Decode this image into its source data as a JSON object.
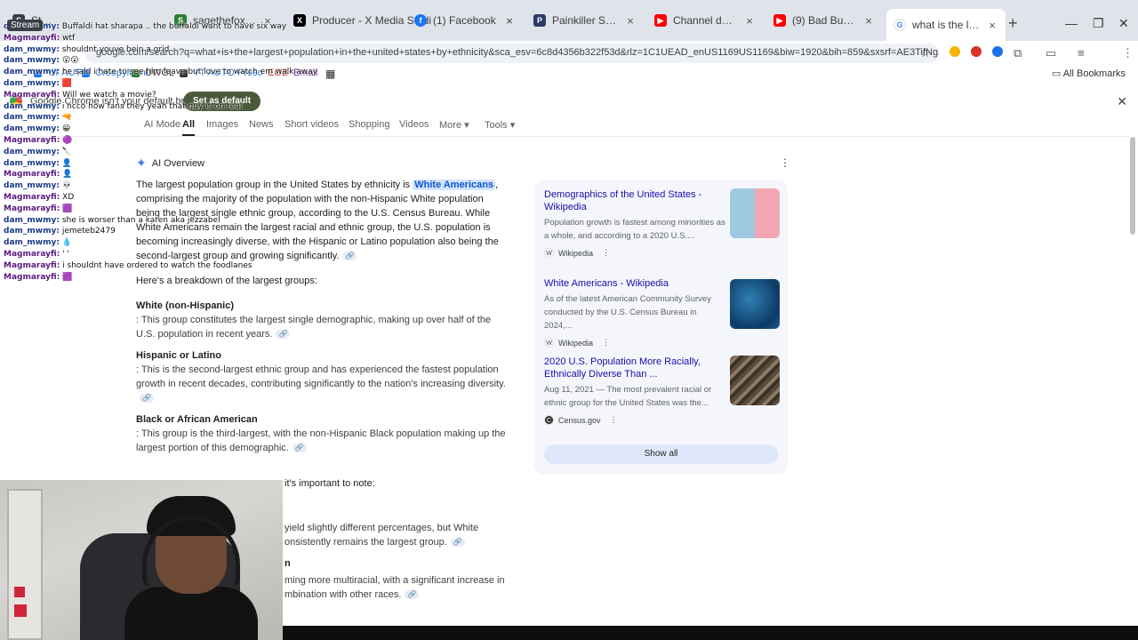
{
  "tabs": [
    {
      "title": "Stream",
      "color": "#3a3f47"
    },
    {
      "title": "sagethefox Stream - ",
      "color": "#2e7d32"
    },
    {
      "title": "Producer - X Media Studi",
      "color": "#000000"
    },
    {
      "title": "(1) Facebook",
      "color": "#1877f2"
    },
    {
      "title": "Painkiller Season 1 Episo",
      "color": "#2b3a67"
    },
    {
      "title": "Channel dashboard - Yo",
      "color": "#ff0000"
    },
    {
      "title": "(9) Bad Bunny - Tití Me P",
      "color": "#ff0000"
    },
    {
      "title": "what is the largest popul",
      "color": "#4285f4"
    }
  ],
  "omnibox": {
    "url": "google.com/search?q=what+is+the+largest+population+in+the+united+states+by+ethnicity&sca_esv=6c8d4356b322f53d&rlz=1C1UEAD_enUS1169US1169&biw=1920&bih=859&sxsrf=AE3TifNg2yAoGcCJo6Zffk7J-rhP6..."
  },
  "bookmarks": {
    "items": [
      {
        "label": "YT AUTO",
        "color": "#1a73e8"
      },
      {
        "label": "CreepyMan",
        "color": "#1a73e8"
      },
      {
        "label": "UWGL",
        "color": "#1f1f1f"
      },
      {
        "label": "YT AUTO",
        "color": "#1a73e8"
      },
      {
        "label": "Preso",
        "color": "#1a73e8"
      },
      {
        "label": "EOB",
        "color": "#c62828"
      },
      {
        "label": "Email",
        "color": "#7b1fa2"
      }
    ],
    "all_label": "All Bookmarks"
  },
  "infobar": {
    "message": "Google Chrome isn't your default browser",
    "button": "Set as default"
  },
  "google_tabs": {
    "ai_mode": "AI Mode",
    "all": "All",
    "images": "Images",
    "news": "News",
    "short_videos": "Short videos",
    "shopping": "Shopping",
    "videos": "Videos",
    "more": "More",
    "tools": "Tools"
  },
  "ai_overview": {
    "label": "AI Overview",
    "intro_before": "The largest population group in the United States by ethnicity is ",
    "intro_highlight": "White Americans",
    "intro_after": ", comprising the majority of the population with the non-Hispanic White population being the largest single ethnic group, according to the U.S. Census Bureau. While White Americans remain the largest racial and ethnic group, the U.S. population is becoming increasingly diverse, with the Hispanic or Latino population also being the second-largest group and growing significantly.",
    "breakdown": "Here's a breakdown of the largest groups:",
    "groups": [
      {
        "title": "White (non-Hispanic)",
        "desc": ": This group constitutes the largest single demographic, making up over half of the U.S. population in recent years."
      },
      {
        "title": "Hispanic or Latino",
        "desc": ": This is the second-largest ethnic group and has experienced the fastest population growth in recent decades, contributing significantly to the nation's increasing diversity."
      },
      {
        "title": "Black or African American",
        "desc": ": This group is the third-largest, with the non-Hispanic Black population making up the largest portion of this demographic."
      }
    ],
    "note": "it's important to note:",
    "cont1": "yield slightly different percentages, but White",
    "cont2": "onsistently remains the largest group.",
    "cont3": "n",
    "cont4": "ming more multiracial, with a significant increase in",
    "cont5": "mbination with other races."
  },
  "sources": [
    {
      "title": "Demographics of the United States - Wikipedia",
      "snippet": "Population growth is fastest among minorities as a whole, and according to a 2020 U.S....",
      "site": "Wikipedia"
    },
    {
      "title": "White Americans - Wikipedia",
      "snippet": "As of the latest American Community Survey conducted by the U.S. Census Bureau in 2024,...",
      "site": "Wikipedia"
    },
    {
      "title": "2020 U.S. Population More Racially, Ethnically Diverse Than ...",
      "snippet": "Aug 11, 2021 — The most prevalent racial or ethnic group for the United States was the...",
      "site": "Census.gov"
    }
  ],
  "show_all": "Show all",
  "chat": [
    {
      "user": "dam_mwmy:",
      "msg": "Buffaldi hat sharapa .. the buffaldi want to have six way"
    },
    {
      "user": "Magmarayfi:",
      "msg": "wtf"
    },
    {
      "user": "dam_mwmy:",
      "msg": "shouldnt youve bein a grid"
    },
    {
      "user": "dam_mwmy:",
      "msg": "😮😮"
    },
    {
      "user": "dam_mwmy:",
      "msg": "he said i hate to see him leave but love to watch em walk away"
    },
    {
      "user": "dam_mwmy:",
      "msg": "🟥"
    },
    {
      "user": "Magmarayfi:",
      "msg": "Will we watch a movie?"
    },
    {
      "user": "dam_mwmy:",
      "msg": "i ncco how fans they yeah that guy is on real"
    },
    {
      "user": "dam_mwmy:",
      "msg": "🔫"
    },
    {
      "user": "dam_mwmy:",
      "msg": "😀"
    },
    {
      "user": "Magmarayfi:",
      "msg": "🟣"
    },
    {
      "user": "dam_mwmy:",
      "msg": "🔪"
    },
    {
      "user": "dam_mwmy:",
      "msg": "👤"
    },
    {
      "user": "Magmarayfi:",
      "msg": "👤"
    },
    {
      "user": "dam_mwmy:",
      "msg": "💀"
    },
    {
      "user": "Magmarayfi:",
      "msg": "XD"
    },
    {
      "user": "Magmarayfi:",
      "msg": "🟪"
    },
    {
      "user": "dam_mwmy:",
      "msg": "she is worser than a karen aka jezzabel"
    },
    {
      "user": "dam_mwmy:",
      "msg": "jemeteb2479"
    },
    {
      "user": "dam_mwmy:",
      "msg": "💧"
    },
    {
      "user": "Magmarayfi:",
      "msg": "' '"
    },
    {
      "user": "Magmarayfi:",
      "msg": "i shouldnt have ordered to watch the foodlanes"
    },
    {
      "user": "Magmarayfi:",
      "msg": "🟪"
    }
  ]
}
